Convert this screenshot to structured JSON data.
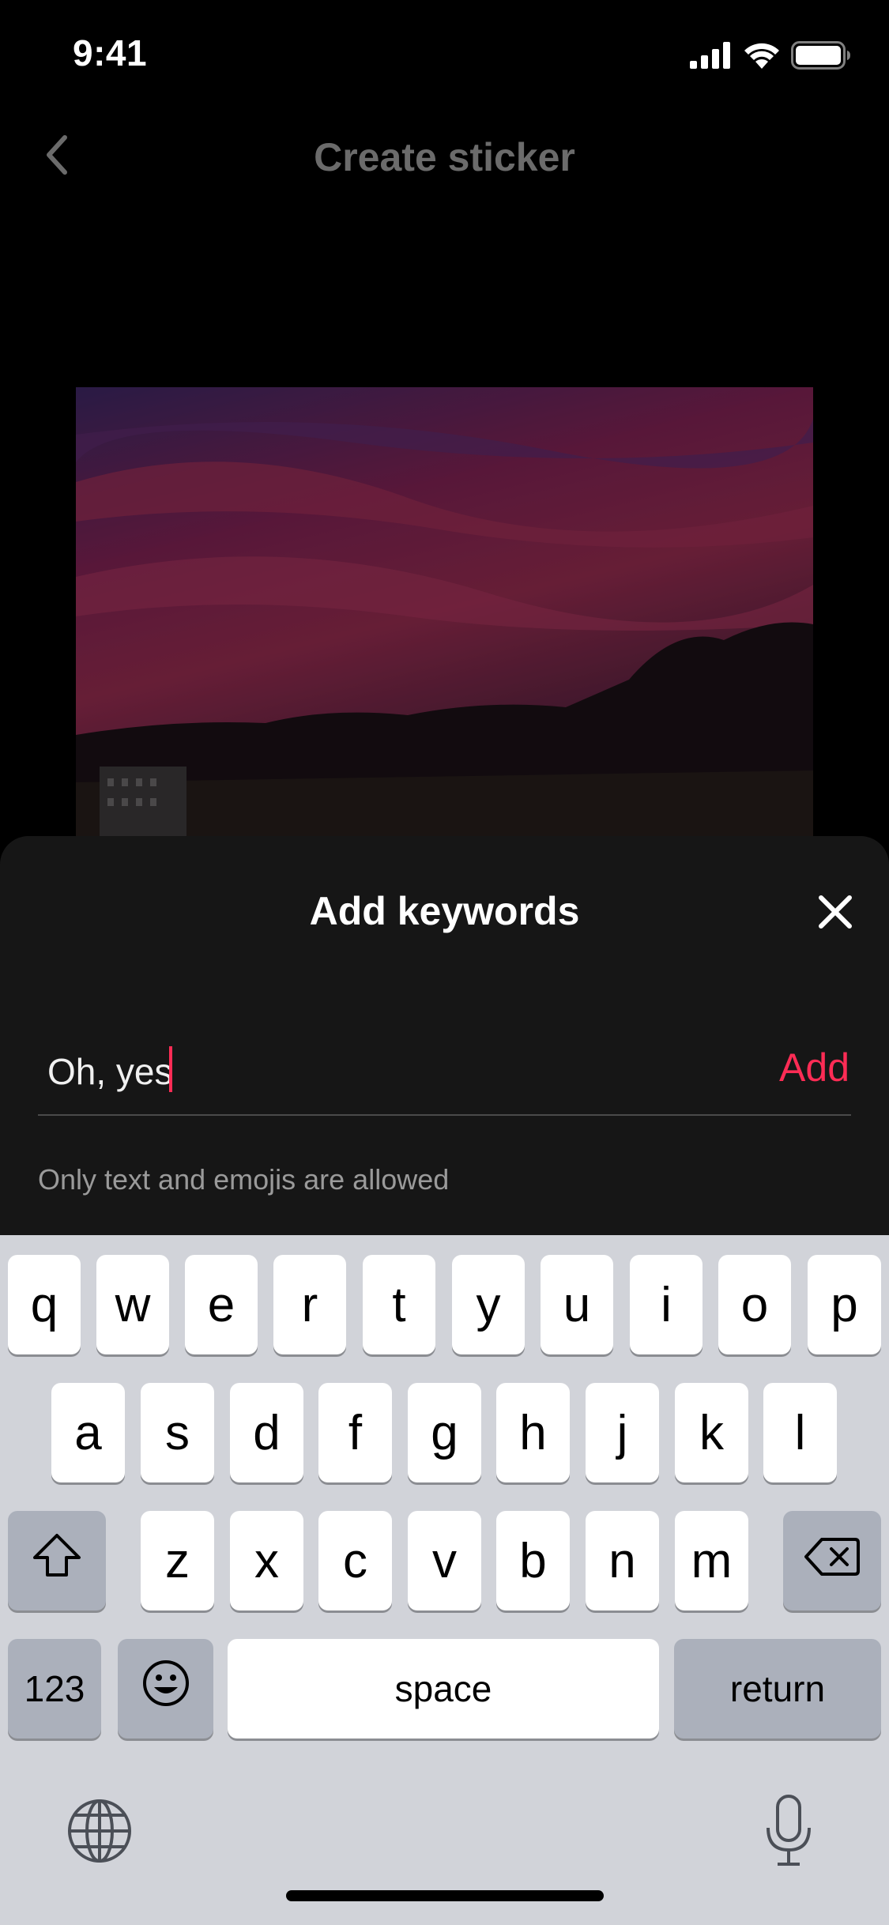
{
  "status_bar": {
    "time": "9:41"
  },
  "nav": {
    "title": "Create sticker"
  },
  "sheet": {
    "title": "Add keywords",
    "input_value": "Oh, yes",
    "add_label": "Add",
    "hint": "Only text and emojis are allowed"
  },
  "keyboard": {
    "row1": [
      "q",
      "w",
      "e",
      "r",
      "t",
      "y",
      "u",
      "i",
      "o",
      "p"
    ],
    "row2": [
      "a",
      "s",
      "d",
      "f",
      "g",
      "h",
      "j",
      "k",
      "l"
    ],
    "row3": [
      "z",
      "x",
      "c",
      "v",
      "b",
      "n",
      "m"
    ],
    "numbers_label": "123",
    "space_label": "space",
    "return_label": "return"
  },
  "colors": {
    "accent": "#fe2c55",
    "sheet_bg": "#161616",
    "keyboard_bg": "#d1d3d9"
  },
  "icons": [
    "signal-icon",
    "wifi-icon",
    "battery-icon",
    "back-chevron-icon",
    "close-icon",
    "shift-icon",
    "delete-icon",
    "emoji-icon",
    "globe-icon",
    "microphone-icon"
  ]
}
